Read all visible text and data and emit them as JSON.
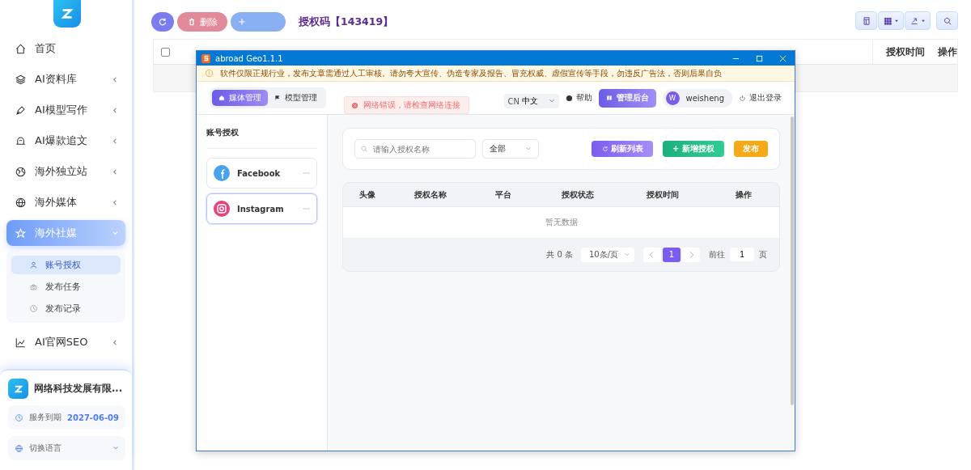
{
  "sidebar": {
    "menu": [
      {
        "label": "首页",
        "arrow": false,
        "selected": false
      },
      {
        "label": "AI资料库",
        "arrow": true,
        "expanded": false,
        "selected": false
      },
      {
        "label": "AI模型写作",
        "arrow": true,
        "expanded": false,
        "selected": false
      },
      {
        "label": "AI爆款追文",
        "arrow": true,
        "expanded": false,
        "selected": false
      },
      {
        "label": "海外独立站",
        "arrow": true,
        "expanded": false,
        "selected": false
      },
      {
        "label": "海外媒体",
        "arrow": true,
        "expanded": false,
        "selected": false
      },
      {
        "label": "海外社媒",
        "arrow": true,
        "expanded": true,
        "selected": true,
        "children": [
          {
            "label": "账号授权",
            "selected": true
          },
          {
            "label": "发布任务",
            "selected": false
          },
          {
            "label": "发布记录",
            "selected": false
          }
        ]
      },
      {
        "label": "AI官网SEO",
        "arrow": true,
        "expanded": false,
        "selected": false
      }
    ],
    "footer": {
      "company": "网络科技发展有限...",
      "service_label": "服务到期",
      "service_date": "2027-06-09",
      "language_label": "切换语言"
    }
  },
  "toolbar": {
    "buttons": [
      {
        "kind": "refresh"
      },
      {
        "kind": "delete",
        "label": "删除"
      },
      {
        "kind": "add"
      }
    ],
    "auth_code": "授权码【143419】",
    "tools": [
      {
        "kind": "table"
      },
      {
        "kind": "grid"
      },
      {
        "kind": "export"
      },
      {
        "kind": "search"
      }
    ]
  },
  "table": {
    "select_all": {
      "checked": false
    },
    "columns": [
      "授权时间",
      "操作"
    ]
  },
  "app": {
    "title": "abroad Geo1.1.1",
    "banner": "软件仅限正规行业，发布文章需通过人工审核。请勿夸大宣传、伪造专家及报告、冒充权威、虚假宣传等手段，勿违反广告法，否则后果自负",
    "toast": "网络错误，请检查网络连接",
    "tabs": [
      {
        "label": "媒体管理",
        "selected": true
      },
      {
        "label": "模型管理",
        "selected": false
      }
    ],
    "language": {
      "code": "CN",
      "label": "中文"
    },
    "help": "帮助",
    "admin": "管理后台",
    "user": {
      "initial": "W",
      "name": "weisheng"
    },
    "logout": "退出登录",
    "panel_title": "账号授权",
    "accounts": [
      {
        "name": "Facebook",
        "kind": "facebook",
        "selected": false
      },
      {
        "name": "Instagram",
        "kind": "instagram",
        "selected": true
      }
    ],
    "search_placeholder": "请输入授权名称",
    "filter": "全部",
    "actions": [
      {
        "label": "刷新列表",
        "kind": "refresh"
      },
      {
        "label": "+ 新增授权",
        "kind": "add"
      },
      {
        "label": "发布",
        "kind": "publish"
      }
    ],
    "columns": [
      "头像",
      "授权名称",
      "平台",
      "授权状态",
      "授权时间",
      "操作"
    ],
    "empty": "暂无数据",
    "pagination": {
      "total": "共 0 条",
      "page_size": "10条/页",
      "pages": [
        {
          "label": "1",
          "selected": true
        }
      ],
      "goto_label": "前往",
      "goto_value": "1",
      "unit": "页"
    }
  }
}
